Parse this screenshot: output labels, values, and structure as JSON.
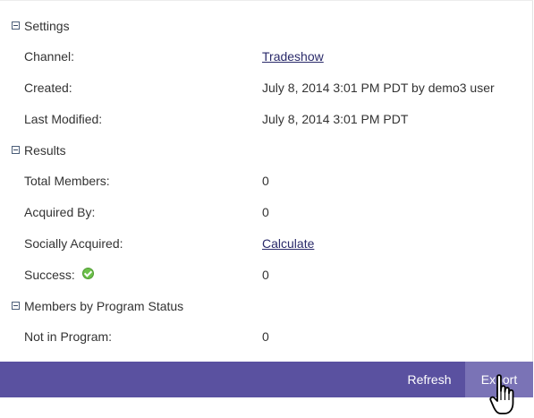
{
  "sections": [
    {
      "title": "Settings",
      "rows": [
        {
          "label": "Channel:",
          "value": "Tradeshow"
        },
        {
          "label": "Created:",
          "value": "July 8, 2014 3:01 PM PDT by demo3 user"
        },
        {
          "label": "Last Modified:",
          "value": "July 8, 2014 3:01 PM PDT"
        }
      ]
    },
    {
      "title": "Results",
      "rows": [
        {
          "label": "Total Members:",
          "value": "0"
        },
        {
          "label": "Acquired By:",
          "value": "0"
        },
        {
          "label": "Socially Acquired:",
          "value": "Calculate"
        },
        {
          "label": "Success:",
          "value": "0",
          "icon": "check-circle-icon"
        }
      ]
    },
    {
      "title": "Members by Program Status",
      "rows": [
        {
          "label": "Not in Program:",
          "value": "0"
        }
      ]
    }
  ],
  "toolbar": {
    "refresh_label": "Refresh",
    "export_label": "Export"
  },
  "colors": {
    "toolbar_bg": "#5a51a0",
    "export_hover_bg": "#7a73b6",
    "link": "#2a2a6a",
    "success_green": "#6cc04a"
  }
}
